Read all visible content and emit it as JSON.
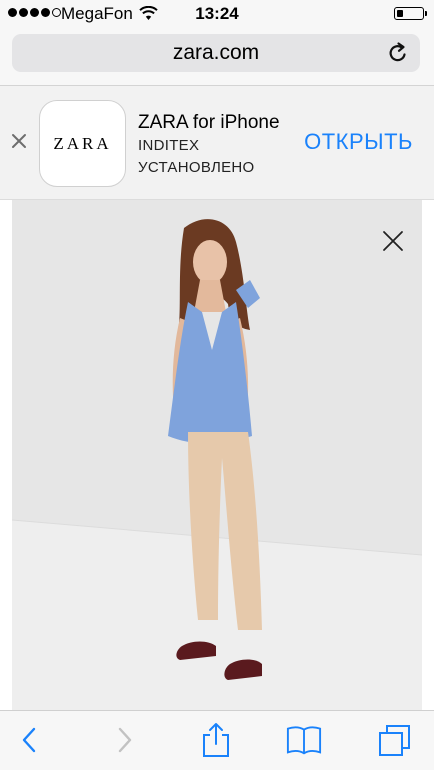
{
  "status_bar": {
    "carrier": "MegaFon",
    "time": "13:24",
    "signal_bars": 4,
    "signal_total": 5,
    "battery_level": 0.25,
    "icons": [
      "wifi-icon",
      "battery-icon"
    ]
  },
  "url_bar": {
    "url": "zara.com",
    "reload_icon": "reload-icon"
  },
  "app_banner": {
    "close_icon": "close-icon",
    "app_icon_text": "ZARA",
    "app_name": "ZARA for iPhone",
    "publisher": "INDITEX",
    "status": "УСТАНОВЛЕНО",
    "open_label": "ОТКРЫТЬ",
    "accent_color": "#1a82fb"
  },
  "product": {
    "close_icon": "close-icon",
    "background_color": "#e6e6e6"
  },
  "toolbar": {
    "items": [
      "back-icon",
      "forward-icon",
      "share-icon",
      "bookmarks-icon",
      "tabs-icon"
    ],
    "tint_color": "#1a82fb"
  }
}
